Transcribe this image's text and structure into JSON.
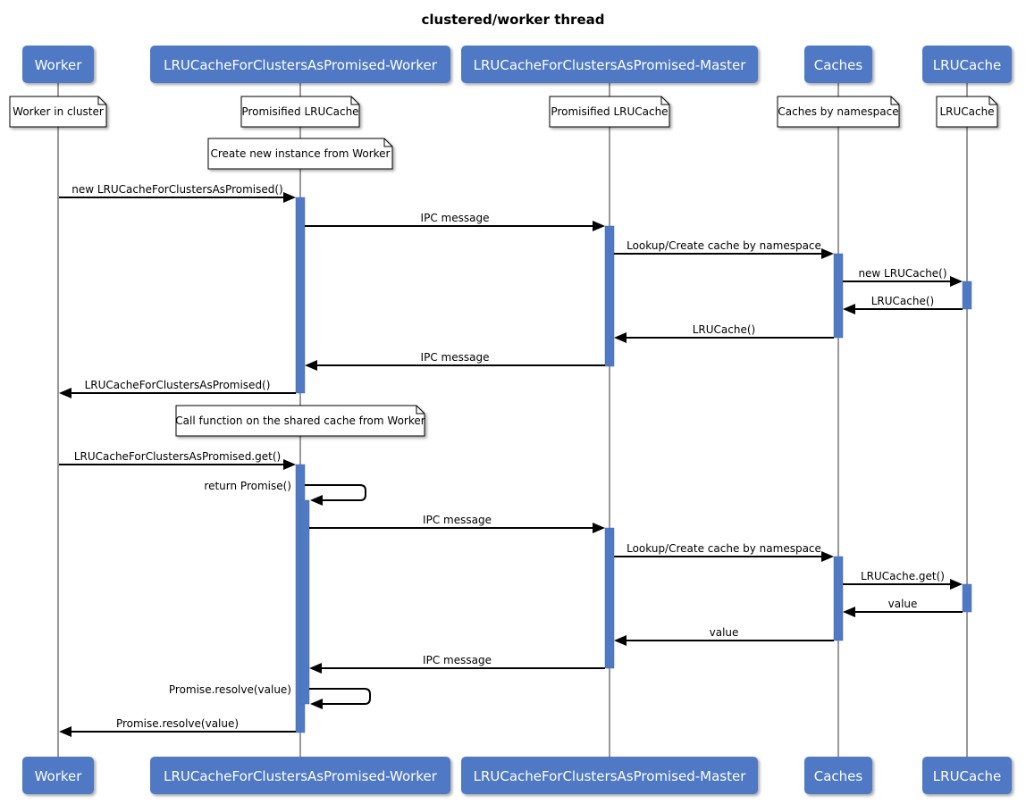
{
  "title": "clustered/worker thread",
  "colors": {
    "actor_fill": "#5079c4",
    "actor_text": "#ffffff",
    "lifeline": "#999999",
    "activation": "#5079c4",
    "note_fill": "#ffffff",
    "note_border": "#000000",
    "arrow": "#000000"
  },
  "participants": [
    {
      "id": "worker",
      "label": "Worker"
    },
    {
      "id": "lru-worker",
      "label": "LRUCacheForClustersAsPromised-Worker"
    },
    {
      "id": "lru-master",
      "label": "LRUCacheForClustersAsPromised-Master"
    },
    {
      "id": "caches",
      "label": "Caches"
    },
    {
      "id": "lrucache",
      "label": "LRUCache"
    }
  ],
  "participant_notes": [
    {
      "participant": 0,
      "text": "Worker in cluster"
    },
    {
      "participant": 1,
      "text": "Promisified LRUCache"
    },
    {
      "participant": 2,
      "text": "Promisified LRUCache"
    },
    {
      "participant": 3,
      "text": "Caches by namespace"
    },
    {
      "participant": 4,
      "text": "LRUCache"
    }
  ],
  "section_notes": [
    {
      "participant": 1,
      "text": "Create new instance from Worker"
    },
    {
      "participant": 1,
      "text": "Call function on the shared cache from Worker"
    }
  ],
  "messages": [
    {
      "from": 0,
      "to": 1,
      "label": "new LRUCacheForClustersAsPromised()",
      "kind": "call"
    },
    {
      "from": 1,
      "to": 2,
      "label": "IPC message",
      "kind": "call"
    },
    {
      "from": 2,
      "to": 3,
      "label": "Lookup/Create cache by namespace",
      "kind": "call"
    },
    {
      "from": 3,
      "to": 4,
      "label": "new LRUCache()",
      "kind": "call"
    },
    {
      "from": 4,
      "to": 3,
      "label": "LRUCache()",
      "kind": "return"
    },
    {
      "from": 3,
      "to": 2,
      "label": "LRUCache()",
      "kind": "return"
    },
    {
      "from": 2,
      "to": 1,
      "label": "IPC message",
      "kind": "return"
    },
    {
      "from": 1,
      "to": 0,
      "label": "LRUCacheForClustersAsPromised()",
      "kind": "return"
    },
    {
      "from": 0,
      "to": 1,
      "label": "LRUCacheForClustersAsPromised.get()",
      "kind": "call"
    },
    {
      "from": 1,
      "to": 1,
      "label": "return Promise()",
      "kind": "self"
    },
    {
      "from": 1,
      "to": 2,
      "label": "IPC message",
      "kind": "call"
    },
    {
      "from": 2,
      "to": 3,
      "label": "Lookup/Create cache by namespace",
      "kind": "call"
    },
    {
      "from": 3,
      "to": 4,
      "label": "LRUCache.get()",
      "kind": "call"
    },
    {
      "from": 4,
      "to": 3,
      "label": "value",
      "kind": "return"
    },
    {
      "from": 3,
      "to": 2,
      "label": "value",
      "kind": "return"
    },
    {
      "from": 2,
      "to": 1,
      "label": "IPC message",
      "kind": "return"
    },
    {
      "from": 1,
      "to": 1,
      "label": "Promise.resolve(value)",
      "kind": "self"
    },
    {
      "from": 1,
      "to": 0,
      "label": "Promise.resolve(value)",
      "kind": "return"
    }
  ]
}
